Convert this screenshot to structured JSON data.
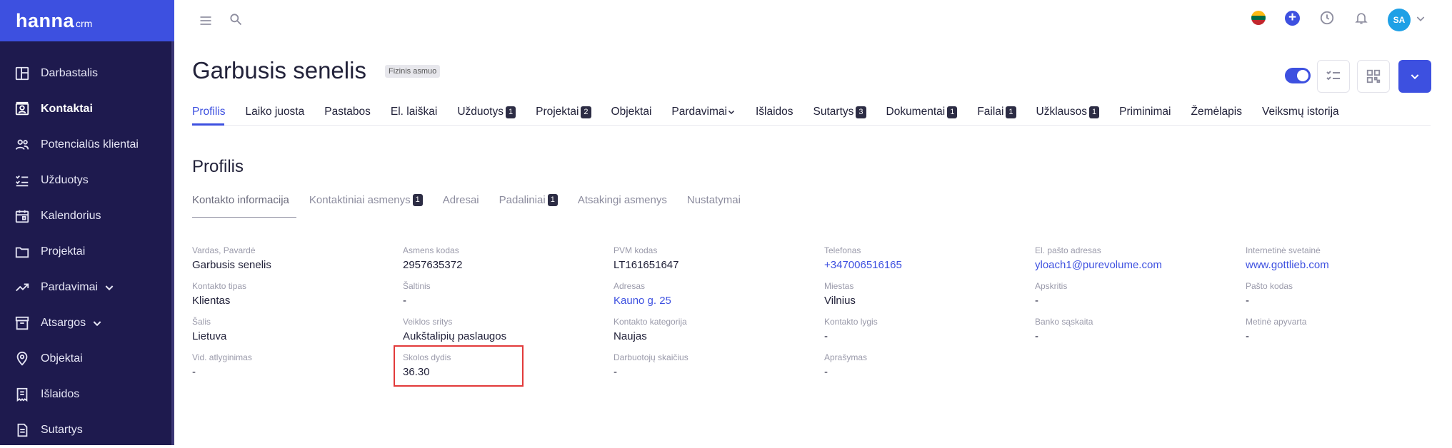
{
  "app": {
    "logo": "hanna",
    "logo_sub": "crm"
  },
  "sidebar": {
    "items": [
      {
        "label": "Darbastalis",
        "icon": "dashboard-icon"
      },
      {
        "label": "Kontaktai",
        "icon": "contacts-icon",
        "active": true
      },
      {
        "label": "Potencialūs klientai",
        "icon": "leads-icon"
      },
      {
        "label": "Užduotys",
        "icon": "tasks-icon"
      },
      {
        "label": "Kalendorius",
        "icon": "calendar-icon"
      },
      {
        "label": "Projektai",
        "icon": "folder-icon"
      },
      {
        "label": "Pardavimai",
        "icon": "trending-icon",
        "expandable": true
      },
      {
        "label": "Atsargos",
        "icon": "inventory-icon",
        "expandable": true
      },
      {
        "label": "Objektai",
        "icon": "location-pin-icon"
      },
      {
        "label": "Išlaidos",
        "icon": "receipt-icon"
      },
      {
        "label": "Sutartys",
        "icon": "document-icon"
      }
    ]
  },
  "topbar": {
    "avatar_initials": "SA"
  },
  "header": {
    "title": "Garbusis senelis",
    "type_badge": "Fizinis asmuo"
  },
  "tabs": [
    {
      "label": "Profilis",
      "active": true
    },
    {
      "label": "Laiko juosta"
    },
    {
      "label": "Pastabos"
    },
    {
      "label": "El. laiškai"
    },
    {
      "label": "Užduotys",
      "count": "1"
    },
    {
      "label": "Projektai",
      "count": "2"
    },
    {
      "label": "Objektai"
    },
    {
      "label": "Pardavimai",
      "dropdown": true
    },
    {
      "label": "Išlaidos"
    },
    {
      "label": "Sutartys",
      "count": "3"
    },
    {
      "label": "Dokumentai",
      "count": "1"
    },
    {
      "label": "Failai",
      "count": "1"
    },
    {
      "label": "Užklausos",
      "count": "1"
    },
    {
      "label": "Priminimai"
    },
    {
      "label": "Žemėlapis"
    },
    {
      "label": "Veiksmų istorija"
    }
  ],
  "section": {
    "title": "Profilis"
  },
  "subtabs": [
    {
      "label": "Kontakto informacija",
      "active": true
    },
    {
      "label": "Kontaktiniai asmenys",
      "count": "1"
    },
    {
      "label": "Adresai"
    },
    {
      "label": "Padaliniai",
      "count": "1"
    },
    {
      "label": "Atsakingi asmenys"
    },
    {
      "label": "Nustatymai"
    }
  ],
  "fields": {
    "vardas": {
      "label": "Vardas, Pavardė",
      "value": "Garbusis senelis"
    },
    "asmens_kodas": {
      "label": "Asmens kodas",
      "value": "2957635372"
    },
    "pvm_kodas": {
      "label": "PVM kodas",
      "value": "LT161651647"
    },
    "telefonas": {
      "label": "Telefonas",
      "value": "+347006516165"
    },
    "el_pastas": {
      "label": "El. pašto adresas",
      "value": "yloach1@purevolume.com"
    },
    "svetaine": {
      "label": "Internetinė svetainė",
      "value": "www.gottlieb.com"
    },
    "kontakto_tipas": {
      "label": "Kontakto tipas",
      "value": "Klientas"
    },
    "saltinis": {
      "label": "Šaltinis",
      "value": "-"
    },
    "adresas": {
      "label": "Adresas",
      "value": "Kauno g. 25"
    },
    "miestas": {
      "label": "Miestas",
      "value": "Vilnius"
    },
    "apskritis": {
      "label": "Apskritis",
      "value": "-"
    },
    "pasto_kodas": {
      "label": "Pašto kodas",
      "value": "-"
    },
    "salis": {
      "label": "Šalis",
      "value": "Lietuva"
    },
    "veiklos_sritys": {
      "label": "Veiklos sritys",
      "value": "Aukštalipių paslaugos"
    },
    "kontakto_kategorija": {
      "label": "Kontakto kategorija",
      "value": "Naujas"
    },
    "kontakto_lygis": {
      "label": "Kontakto lygis",
      "value": "-"
    },
    "banko_saskaita": {
      "label": "Banko sąskaita",
      "value": "-"
    },
    "metine_apyvarta": {
      "label": "Metinė apyvarta",
      "value": "-"
    },
    "vid_atlyginimas": {
      "label": "Vid. atlyginimas",
      "value": "-"
    },
    "skolos_dydis": {
      "label": "Skolos dydis",
      "value": "36.30"
    },
    "darbuotoju_skaicius": {
      "label": "Darbuotojų skaičius",
      "value": "-"
    },
    "aprasymas": {
      "label": "Aprašymas",
      "value": "-"
    }
  },
  "colors": {
    "accent": "#3d50e0",
    "sidebar": "#1e1a4e",
    "highlight": "#e23a3a"
  }
}
